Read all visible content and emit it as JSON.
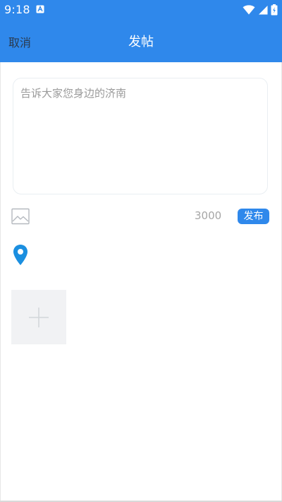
{
  "status_bar": {
    "time": "9:18",
    "icons": [
      "a-notification-icon",
      "wifi-icon",
      "signal-icon",
      "battery-icon"
    ]
  },
  "nav": {
    "cancel_label": "取消",
    "title": "发帖"
  },
  "post": {
    "content_placeholder": "告诉大家您身边的济南",
    "content_value": "",
    "char_count": "3000",
    "publish_label": "发布"
  },
  "icons": {
    "image": "image-icon",
    "location": "location-pin-icon",
    "add_photo": "plus-icon"
  },
  "colors": {
    "primary": "#2f88eb",
    "location_pin": "#1b8fe0",
    "placeholder": "#9a9a9a",
    "add_tile_bg": "#f1f2f4"
  }
}
